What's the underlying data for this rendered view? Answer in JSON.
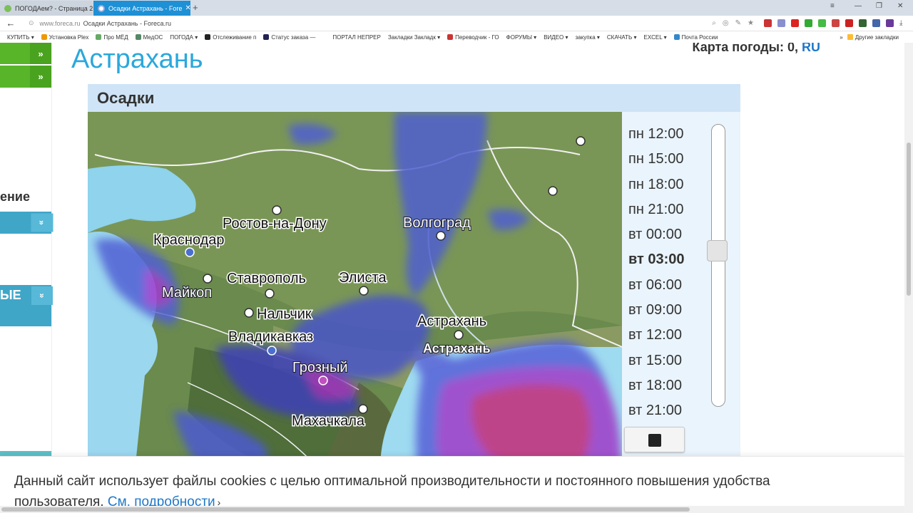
{
  "browser": {
    "tabs": [
      {
        "title": "ПОГОДАем? - Страница 2ё",
        "active": false
      },
      {
        "title": "Осадки Астрахань - Fore",
        "active": true
      }
    ],
    "address": {
      "domain": "www.foreca.ru",
      "title": "Осадки Астрахань - Foreca.ru"
    },
    "bookmarks": [
      "КУПИТЬ ▾",
      "Установка Plex",
      "Про МЁД",
      "МедОС",
      "ПОГОДА ▾",
      "Отслеживание п",
      "Статус заказа —",
      "ПОРТАЛ НЕПРЕР",
      "Закладки Закладк ▾",
      "Переводчик - ГО",
      "ФОРУМЫ ▾",
      "ВИДЕО ▾",
      "закупка ▾",
      "СКАЧАТЬ ▾",
      "EXCEL ▾",
      "Почта России"
    ],
    "other_bookmarks": "Другие закладки",
    "colors": {
      "tab_active": "#1e90d6",
      "tabbar": "#d6dde6"
    }
  },
  "left_panel": {
    "partial_text_1": "ение",
    "partial_text_2": "ЫЕ"
  },
  "header": {
    "city": "Астрахань",
    "map_count_label": "Карта погоды: 0,",
    "lang": "RU"
  },
  "precip": {
    "title": "Осадки",
    "timeline": [
      "пн 12:00",
      "пн 15:00",
      "пн 18:00",
      "пн 21:00",
      "вт 00:00",
      "вт 03:00",
      "вт 06:00",
      "вт 09:00",
      "вт 12:00",
      "вт 15:00",
      "вт 18:00",
      "вт 21:00"
    ],
    "active_time": "вт 03:00",
    "map_labels": {
      "krasnodar": "Краснодар",
      "rostov": "Ростов-на-Дону",
      "volgograd": "Волгоград",
      "stavropol": "Ставрополь",
      "elista": "Элиста",
      "maikop": "Майкоп",
      "nalchik": "Нальчик",
      "vladikavkaz": "Владикавказ",
      "astrakhan": "Астрахань",
      "astrakhan_selected": "Астрахань",
      "grozny": "Грозный",
      "makhachkala": "Махачкала"
    }
  },
  "cookie": {
    "text": "Данный сайт использует файлы cookies с целью оптимальной производительности и постоянного повышения удобства пользователя.",
    "link": "См. подробности",
    "arrow": "›"
  }
}
